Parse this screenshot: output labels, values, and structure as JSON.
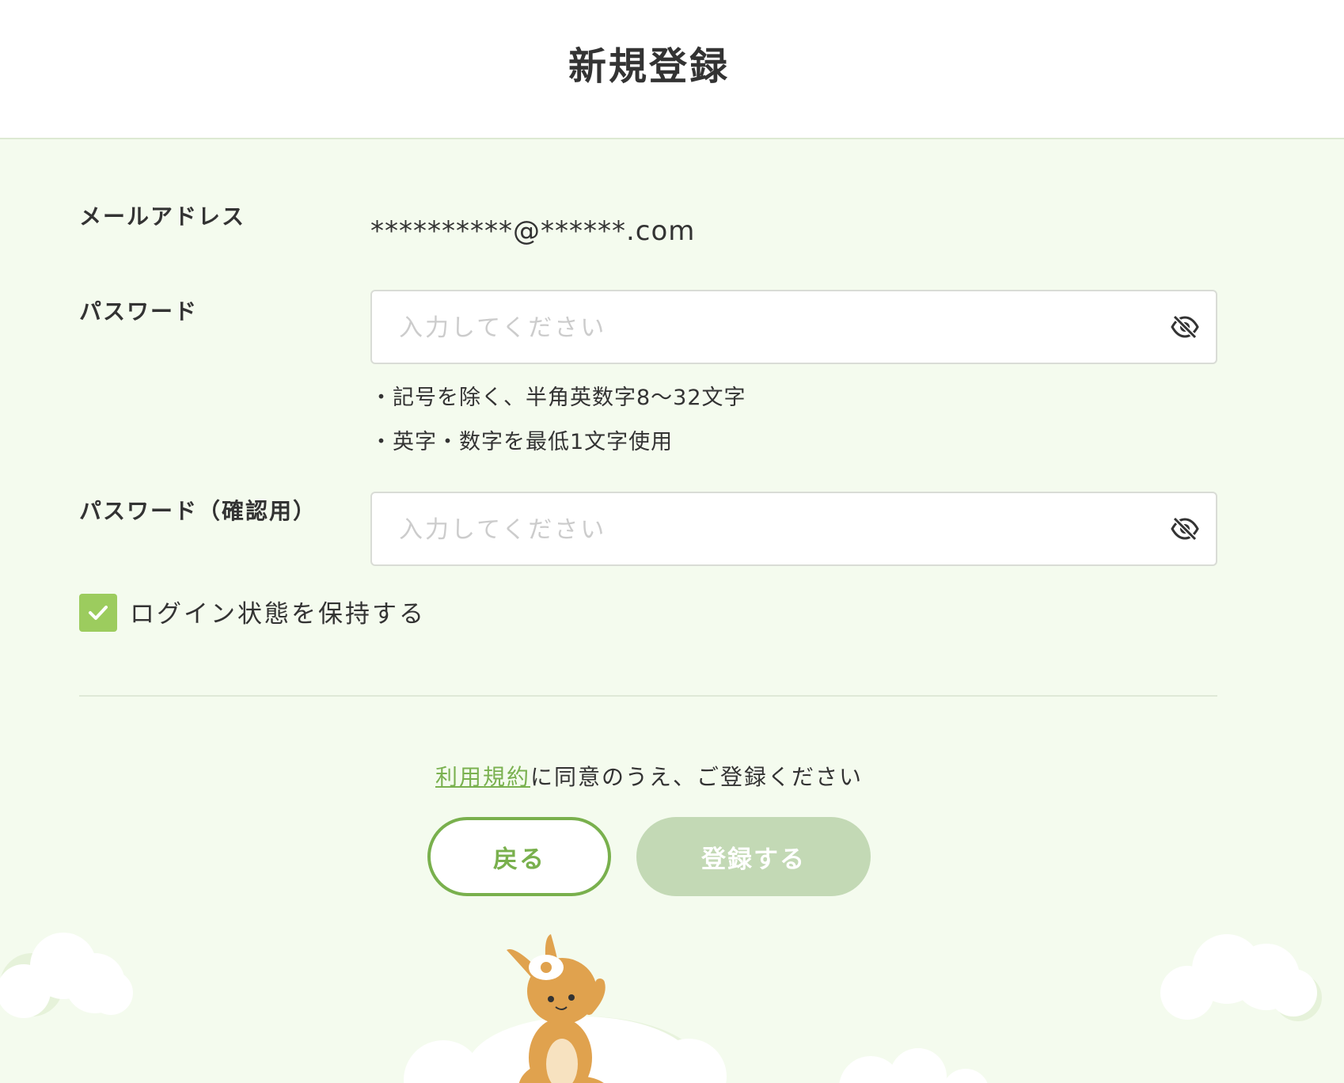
{
  "header": {
    "title": "新規登録"
  },
  "form": {
    "email": {
      "label": "メールアドレス",
      "value": "**********@******.com"
    },
    "password": {
      "label": "パスワード",
      "placeholder": "入力してください",
      "toggle_icon": "eye-slash-icon",
      "hints": [
        "・記号を除く、半角英数字8〜32文字",
        "・英字・数字を最低1文字使用"
      ]
    },
    "password_confirm": {
      "label": "パスワード（確認用）",
      "placeholder": "入力してください",
      "toggle_icon": "eye-slash-icon"
    },
    "keep_login": {
      "label": "ログイン状態を保持する",
      "checked": true
    }
  },
  "footer": {
    "terms_link": "利用規約",
    "terms_text": "に同意のうえ、ご登録ください",
    "back_label": "戻る",
    "register_label": "登録する"
  },
  "colors": {
    "accent": "#79b04d",
    "checkbox": "#9ccc5e",
    "register_disabled": "#c3d9b5",
    "background": "#f4fbee"
  }
}
